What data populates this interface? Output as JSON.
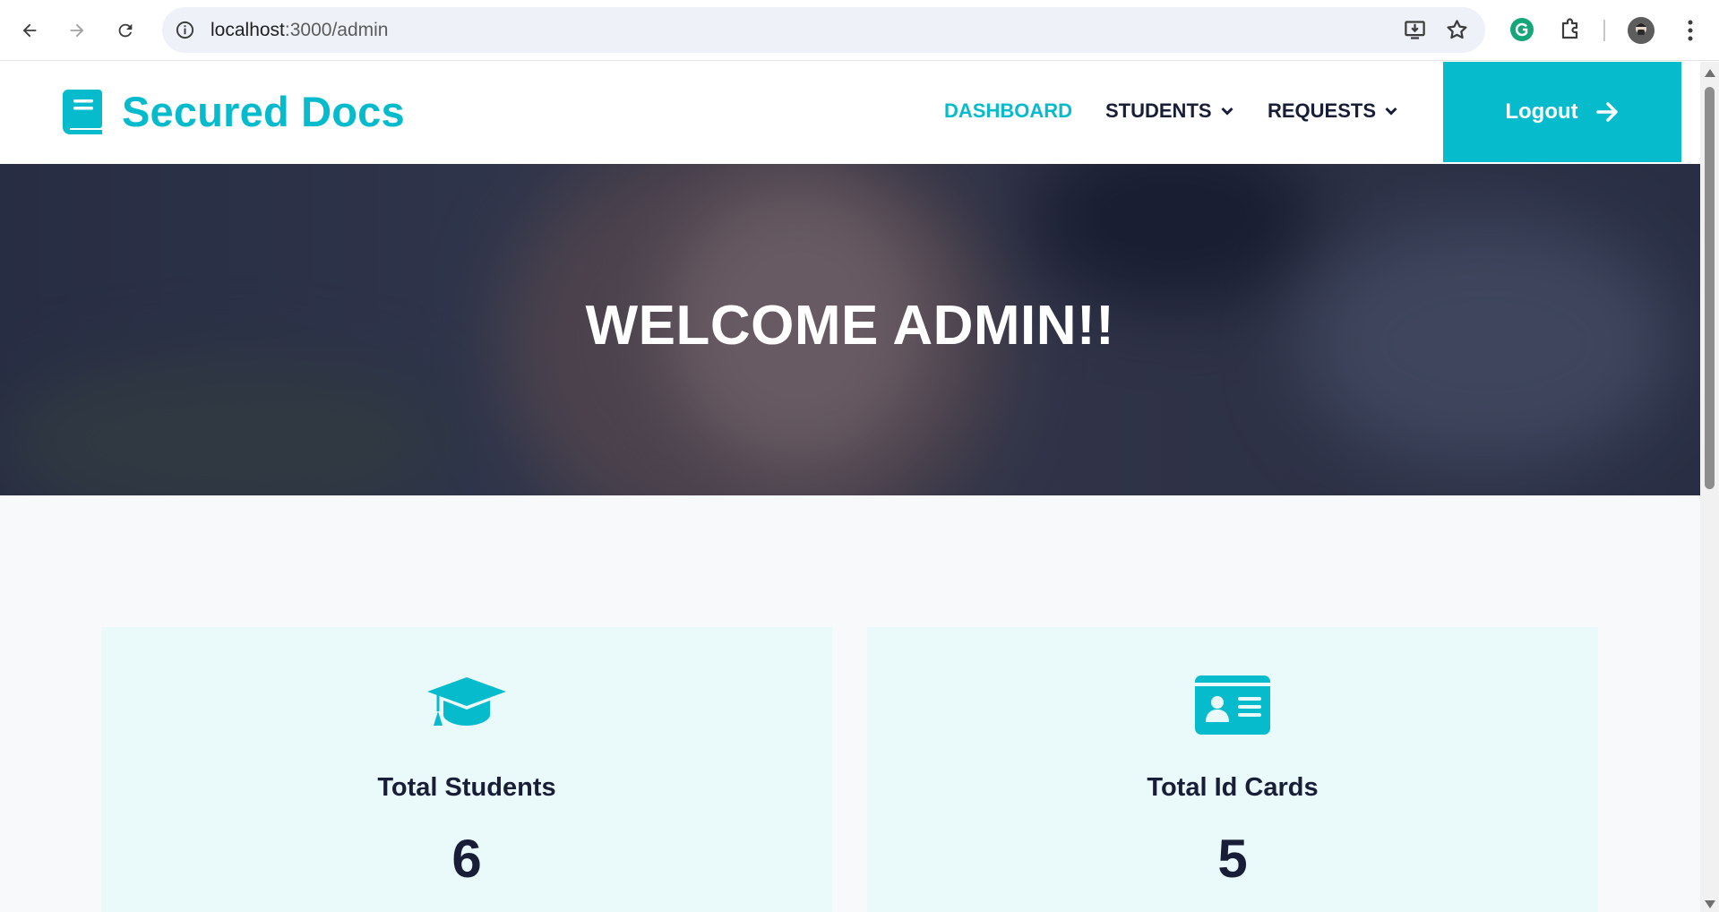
{
  "browser": {
    "url_host": "localhost",
    "url_path": ":3000/admin"
  },
  "site": {
    "brand_name": "Secured Docs",
    "menu": {
      "dashboard": "DASHBOARD",
      "students": "STUDENTS",
      "requests": "REQUESTS"
    },
    "logout_label": "Logout"
  },
  "hero": {
    "title": "WELCOME ADMIN!!"
  },
  "stats": [
    {
      "label": "Total Students",
      "value": "6",
      "icon": "graduation-cap-icon"
    },
    {
      "label": "Total Id Cards",
      "value": "5",
      "icon": "id-card-icon"
    }
  ],
  "colors": {
    "accent": "#06bbcc",
    "dark": "#181d38"
  }
}
